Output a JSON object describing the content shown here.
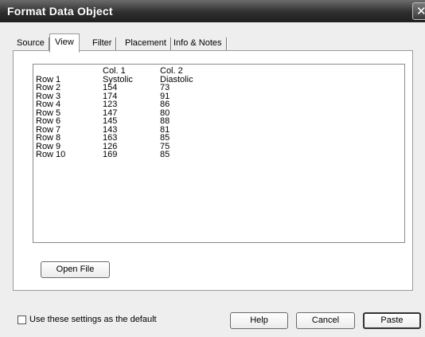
{
  "window": {
    "title": "Format Data Object"
  },
  "tabs": [
    {
      "label": "Source",
      "active": false
    },
    {
      "label": "View",
      "active": true
    },
    {
      "label": "Filter",
      "active": false
    },
    {
      "label": "Placement",
      "active": false
    },
    {
      "label": "Info & Notes",
      "active": false
    }
  ],
  "table": {
    "header": [
      "",
      "Col. 1",
      "Col. 2"
    ],
    "rows": [
      [
        "Row 1",
        "Systolic",
        "Diastolic"
      ],
      [
        "Row 2",
        "154",
        "73"
      ],
      [
        "Row 3",
        "174",
        "91"
      ],
      [
        "Row 4",
        "123",
        "86"
      ],
      [
        "Row 5",
        "147",
        "80"
      ],
      [
        "Row 6",
        "145",
        "88"
      ],
      [
        "Row 7",
        "143",
        "81"
      ],
      [
        "Row 8",
        "163",
        "85"
      ],
      [
        "Row 9",
        "126",
        "75"
      ],
      [
        "Row 10",
        "169",
        "85"
      ]
    ]
  },
  "buttons": {
    "open_file": "Open File",
    "help": "Help",
    "cancel": "Cancel",
    "paste": "Paste"
  },
  "default_checkbox": {
    "label": "Use these settings as the default",
    "checked": false
  },
  "icons": {
    "close": "close-icon"
  },
  "colors": {
    "titlebar": "#2f2f2f",
    "dialog_bg": "#eeeeee",
    "panel_bg": "#ffffff"
  }
}
